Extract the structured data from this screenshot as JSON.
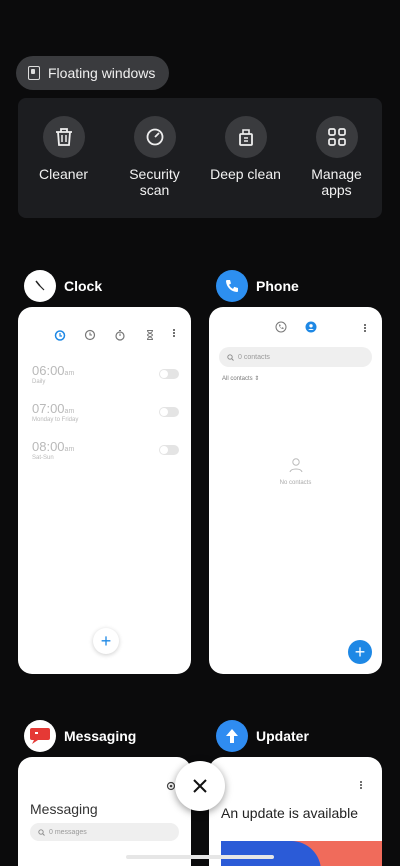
{
  "floating_windows": {
    "label": "Floating windows",
    "icon": "floating-window-icon"
  },
  "tools": [
    {
      "label": "Cleaner",
      "icon": "trash-icon"
    },
    {
      "label": "Security\nscan",
      "icon": "security-scan-icon"
    },
    {
      "label": "Deep clean",
      "icon": "deep-clean-icon"
    },
    {
      "label": "Manage\napps",
      "icon": "grid-apps-icon"
    }
  ],
  "apps": {
    "clock": {
      "title": "Clock",
      "alarms": [
        {
          "time": "06:00",
          "ampm": "am",
          "repeat": "Daily"
        },
        {
          "time": "07:00",
          "ampm": "am",
          "repeat": "Monday to Friday"
        },
        {
          "time": "08:00",
          "ampm": "am",
          "repeat": "Sat-Sun"
        }
      ]
    },
    "phone": {
      "title": "Phone",
      "search_placeholder": "0 contacts",
      "filter": "All contacts",
      "empty": "No contacts"
    },
    "messaging": {
      "title": "Messaging",
      "heading": "Messaging",
      "search_placeholder": "0 messages"
    },
    "updater": {
      "title": "Updater",
      "heading": "An update is available"
    }
  },
  "colors": {
    "accent": "#1e88e5",
    "messaging": "#e53935",
    "updater": "#2f8cf1"
  }
}
